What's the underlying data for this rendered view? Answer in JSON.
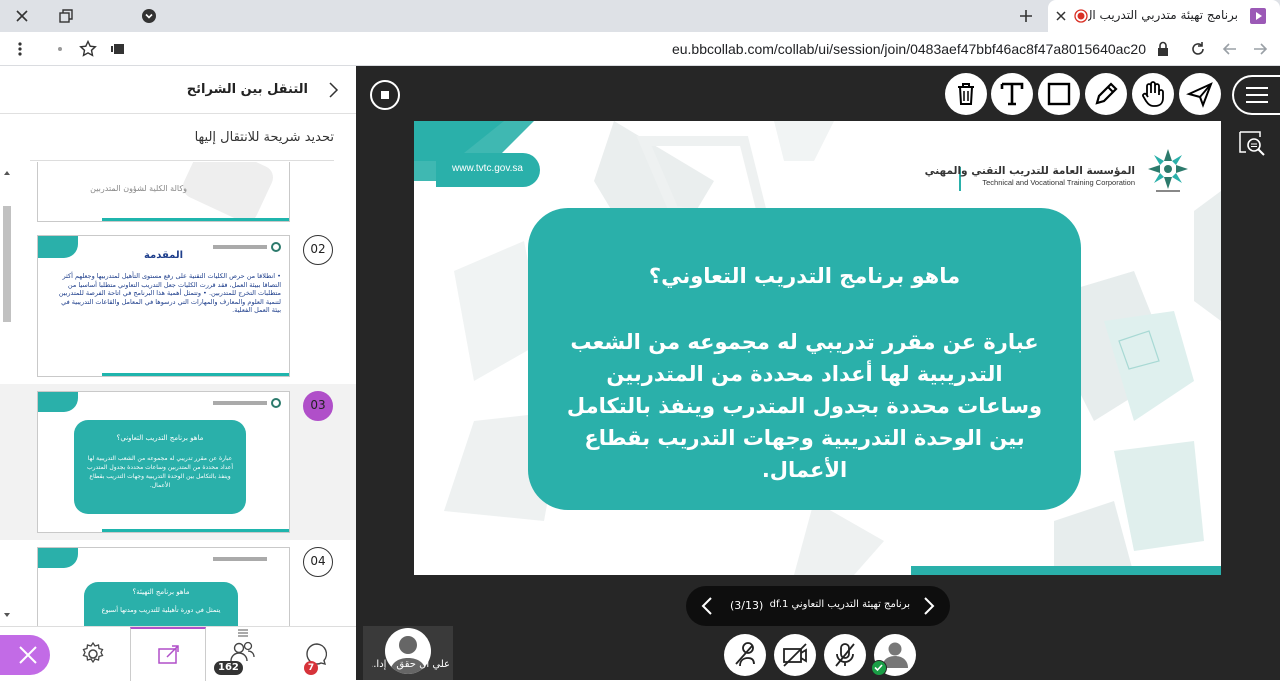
{
  "browser": {
    "tab_title": "برنامج تهيئة متدربي التدريب ال",
    "url": "eu.bbcollab.com/collab/ui/session/join/0483aef47bbf46ac8f47a8015640ac20"
  },
  "left_panel": {
    "title": "التنقل بين الشرائح",
    "subtitle": "تحديد شريحة للانتقال إليها",
    "slides": [
      {
        "number": "02",
        "heading": "المقدمة",
        "text": "• انطلاقا من حرص الكليات التقنية على رفع مستوى التأهيل لمتدربيها وجعلهم أكثر التصاقا ببيئة العمل، فقد قررت الكليات جعل التدريب التعاوني متطلبا أساسيا من متطلبات التخرج للمتدربين. • وتتمثل أهمية هذا البرنامج في اتاحة الفرصة للمتدربين لتنمية العلوم والمعارف والمهارات التي درسوها في المعامل والقاعات التدريبية في بيئة العمل الفعلية."
      },
      {
        "number": "03",
        "heading": "ماهو برنامج التدريب التعاوني؟",
        "text": "عبارة عن مقرر تدريبي له مجموعه من الشعب التدريبية لها أعداد محددة من المتدربين وساعات محددة بجدول المتدرب وينفذ بالتكامل بين الوحدة التدريبية وجهات التدريب بقطاع الأعمال."
      },
      {
        "number": "04",
        "heading": "ماهو برنامج التهيئة؟",
        "text": "يتمثل في دورة تأهيلية للتدريب ومدتها أسبوع"
      }
    ],
    "partial_top_text": "وكالة الكلية لشؤون المتدربين",
    "participants_count": "162",
    "chat_count": "7"
  },
  "slide": {
    "website": "www.tvtc.gov.sa",
    "org_name_ar": "المؤسسة العامة للتدريب التقني والمهني",
    "org_name_en": "Technical and Vocational Training Corporation",
    "question": "ماهو برنامج التدريب التعاوني؟",
    "answer": "عبارة عن مقرر تدريبي له مجموعه من الشعب التدريبية لها أعداد محددة من المتدربين وساعات محددة بجدول المتدرب وينفذ بالتكامل بين الوحدة التدريبية وجهات التدريب بقطاع الأعمال."
  },
  "navigator": {
    "filename": "برنامج تهيئة التدريب التعاوني pdf.1",
    "position": "(3/13)"
  },
  "presenter": {
    "name": "علي آل حقق - إدا..."
  },
  "colors": {
    "teal": "#2ab0aa",
    "active_slide": "#b04fc9",
    "close_purple": "#c26be6",
    "badge_red": "#d6333a",
    "stage_bg": "#262626"
  }
}
